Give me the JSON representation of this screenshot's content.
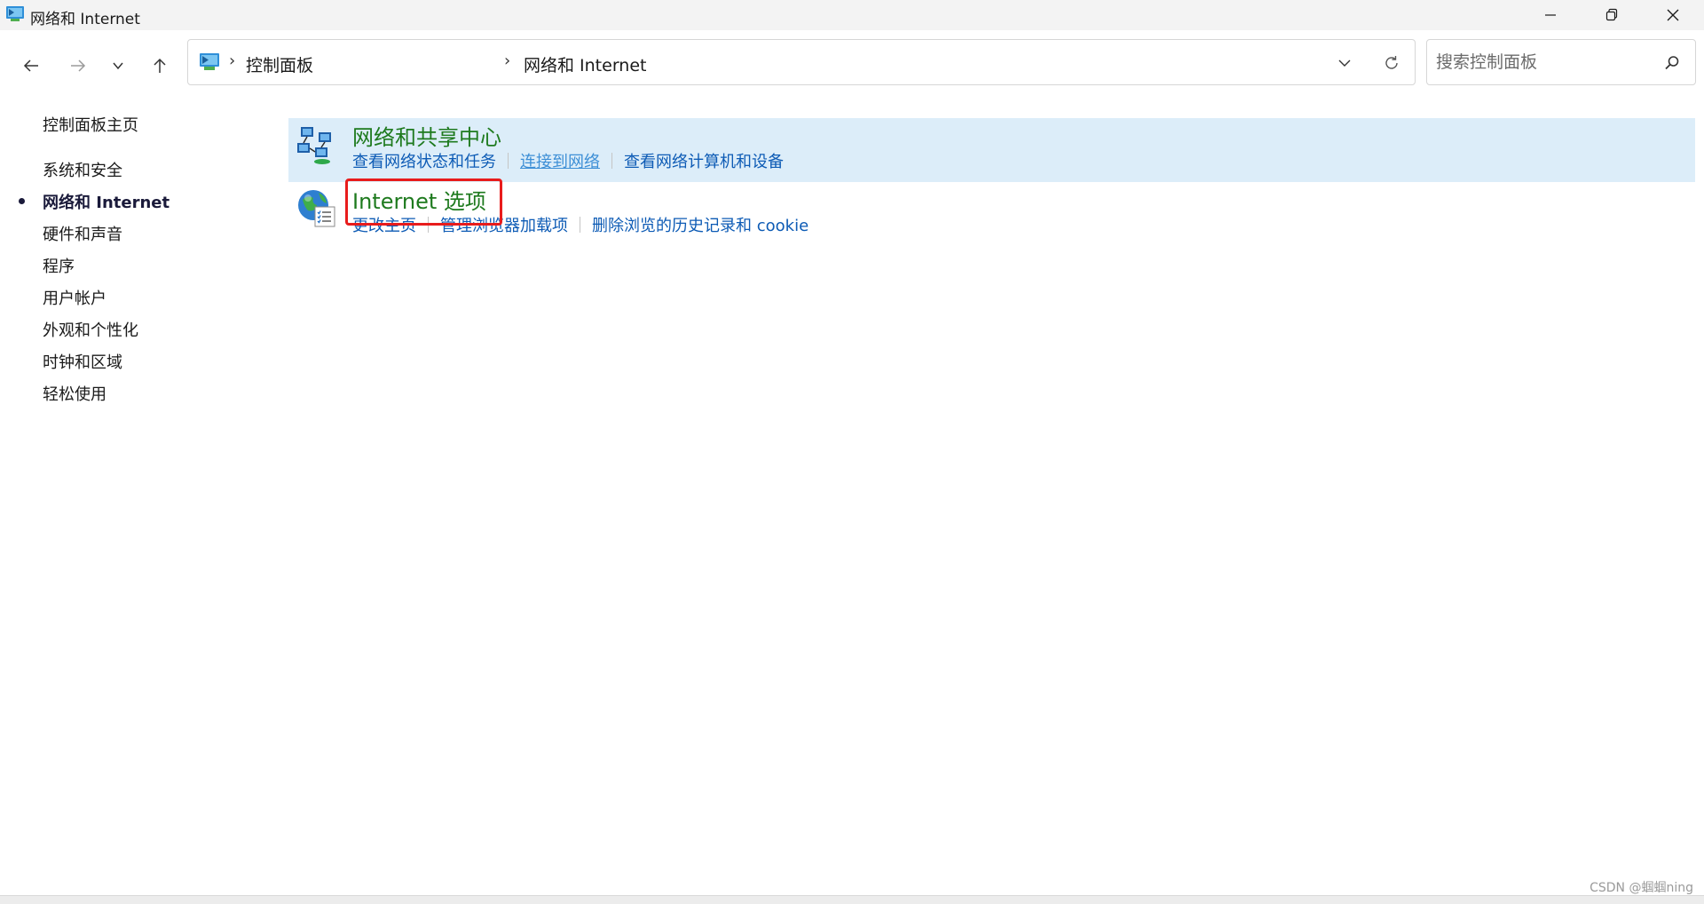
{
  "window": {
    "title": "网络和 Internet"
  },
  "nav": {
    "breadcrumb": [
      "控制面板",
      "网络和 Internet"
    ],
    "search_placeholder": "搜索控制面板"
  },
  "sidebar": {
    "items": [
      {
        "label": "控制面板主页"
      },
      {
        "label": "系统和安全"
      },
      {
        "label": "网络和 Internet",
        "active": true
      },
      {
        "label": "硬件和声音"
      },
      {
        "label": "程序"
      },
      {
        "label": "用户帐户"
      },
      {
        "label": "外观和个性化"
      },
      {
        "label": "时钟和区域"
      },
      {
        "label": "轻松使用"
      }
    ]
  },
  "main": {
    "categories": [
      {
        "title": "网络和共享中心",
        "icon": "network-sharing-icon",
        "links": [
          "查看网络状态和任务",
          "连接到网络",
          "查看网络计算机和设备"
        ]
      },
      {
        "title": "Internet 选项",
        "icon": "internet-options-icon",
        "links": [
          "更改主页",
          "管理浏览器加载项",
          "删除浏览的历史记录和 cookie"
        ]
      }
    ]
  },
  "watermark": "CSDN @蝈蝈ning",
  "colors": {
    "category_title": "#1e7a1e",
    "task_link": "#0d5bb5",
    "highlight_row": "#dcedf9",
    "annotation_box": "#e81c1c"
  }
}
